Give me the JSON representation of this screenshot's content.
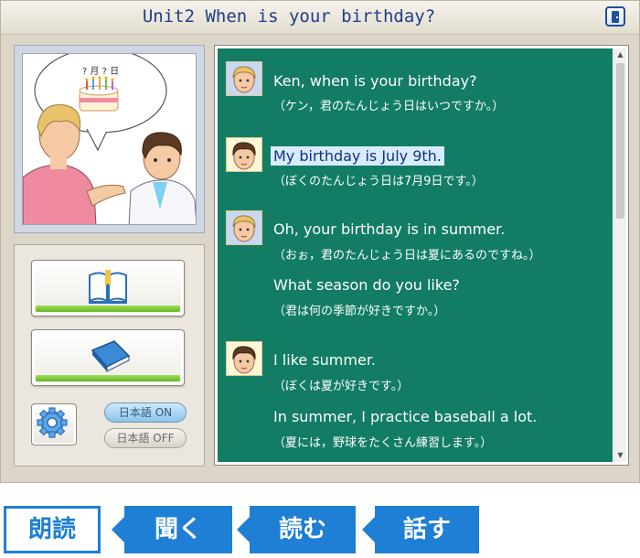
{
  "window": {
    "title": "Unit2 When is your birthday?",
    "exit_icon": "door-exit-icon"
  },
  "illustration": {
    "bubble_text": "? 月 ? 日",
    "cake_icon": "birthday-cake-icon"
  },
  "controls": {
    "read_book_button_icon": "open-book-icon",
    "closed_book_button_icon": "closed-book-icon",
    "settings_icon": "gear-icon",
    "japanese_on_label": "日本語 ON",
    "japanese_off_label": "日本語 OFF"
  },
  "chat": {
    "messages": [
      {
        "speaker_icon": "blond-boy-avatar-icon",
        "en": "Ken, when is your birthday?",
        "jp": "（ケン，君のたんじょう日はいつですか。）"
      },
      {
        "speaker_icon": "dark-haired-boy-avatar-icon",
        "en": "My birthday is July 9th.",
        "jp": "（ぼくのたんじょう日は7月9日です。）",
        "highlighted": true
      },
      {
        "speaker_icon": "blond-boy-avatar-icon",
        "en": "Oh, your birthday is in summer.",
        "jp": "（おぉ，君のたんじょう日は夏にあるのですね。）",
        "en2": "What season do you like?",
        "jp2": "（君は何の季節が好きですか。）"
      },
      {
        "speaker_icon": "dark-haired-boy-avatar-icon",
        "en": "I like summer.",
        "jp": "（ぼくは夏が好きです。）",
        "en2": "In summer, I practice baseball a lot.",
        "jp2": "（夏には，野球をたくさん練習します。）"
      }
    ],
    "scroll_up": "▲",
    "scroll_down": "▼"
  },
  "tabs": {
    "read_aloud": "朗読",
    "listen": "聞く",
    "read": "読む",
    "speak": "話す"
  },
  "colors": {
    "chat_background": "#127c65",
    "accent_blue": "#1e7fd4",
    "title_blue": "#1f3d8a",
    "highlight": "#d7ecff",
    "progress_green": "#67b824"
  }
}
